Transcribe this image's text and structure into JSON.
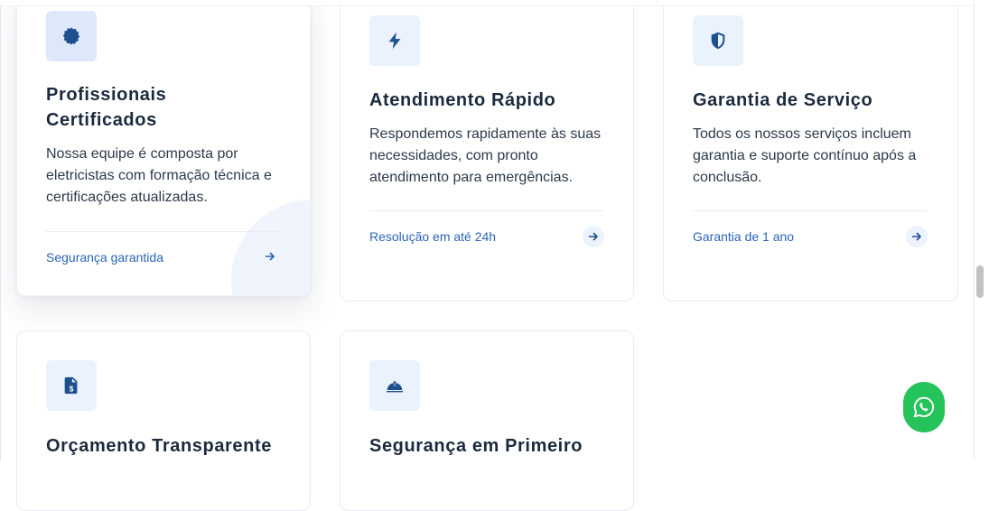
{
  "colors": {
    "accent": "#2a64b8",
    "icon": "#1e4f8e",
    "icon_bg": "#eaf2fd",
    "whatsapp": "#25c45a"
  },
  "cards": [
    {
      "icon": "badge-icon",
      "title_line1": "Profissionais",
      "title_line2": "Certificados",
      "description": "Nossa equipe é composta por eletricistas com formação técnica e certificações atualizadas.",
      "link": "Segurança garantida"
    },
    {
      "icon": "lightning-icon",
      "title": "Atendimento Rápido",
      "description": "Respondemos rapidamente às suas necessidades, com pronto atendimento para emergências.",
      "link": "Resolução em até 24h"
    },
    {
      "icon": "shield-icon",
      "title": "Garantia de Serviço",
      "description": "Todos os nossos serviços incluem garantia e suporte contínuo após a conclusão.",
      "link": "Garantia de 1 ano"
    },
    {
      "icon": "invoice-icon",
      "title": "Orçamento Transparente"
    },
    {
      "icon": "helmet-icon",
      "title": "Segurança em Primeiro"
    }
  ],
  "whatsapp": {
    "icon": "whatsapp-icon"
  }
}
